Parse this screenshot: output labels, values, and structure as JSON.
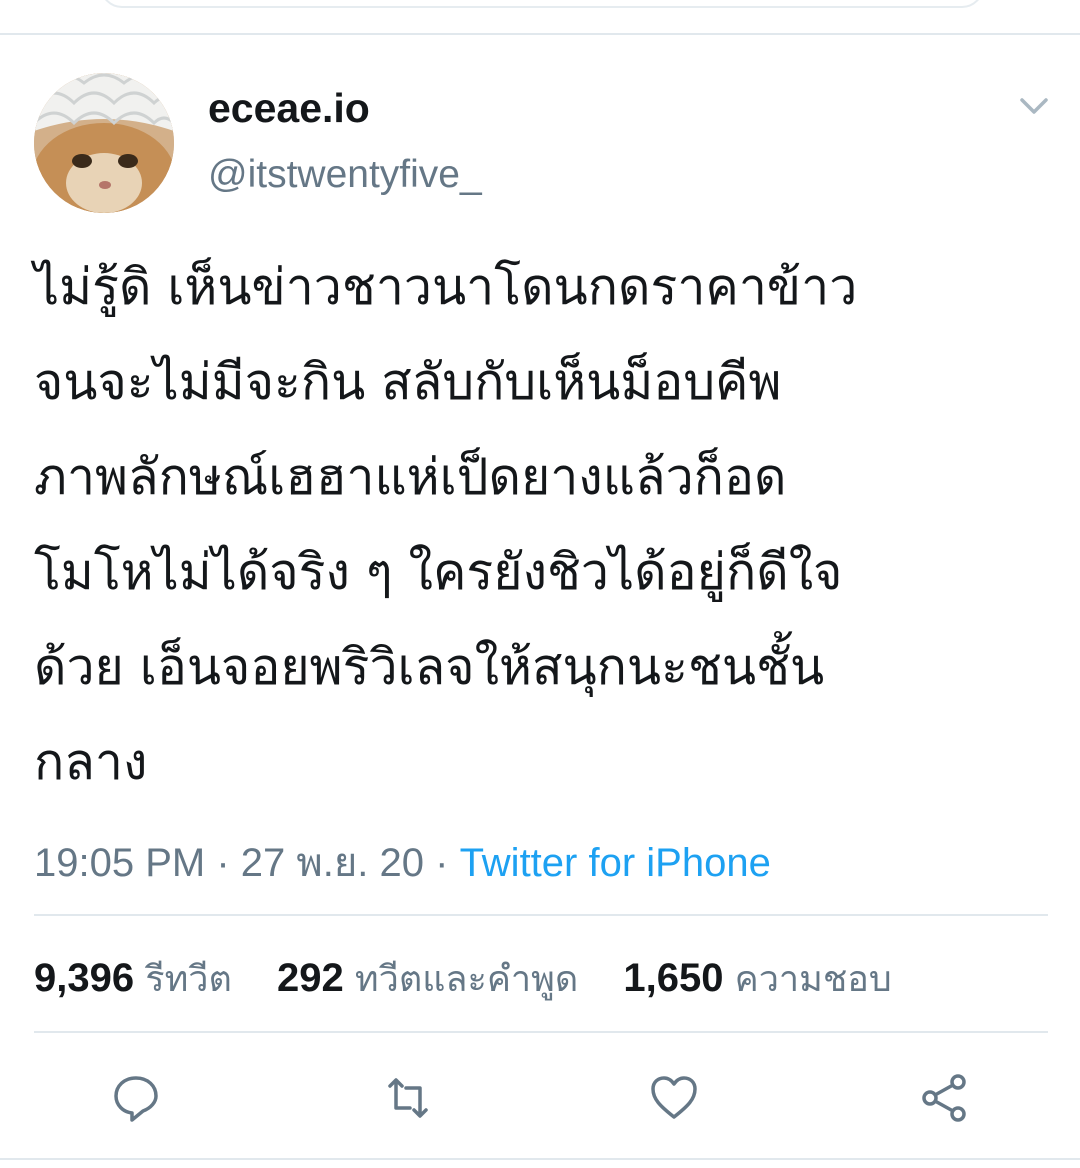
{
  "user": {
    "display_name": "eceae.io",
    "handle": "@itstwentyfive_"
  },
  "tweet": {
    "text": "ไม่รู้ดิ เห็นข่าวชาวนาโดนกดราคาข้าว\nจนจะไม่มีจะกิน สลับกับเห็นม็อบคีพ\nภาพลักษณ์เฮฮาแห่เป็ดยางแล้วก็อด\nโมโหไม่ได้จริง ๆ ใครยังชิวได้อยู่ก็ดีใจ\nด้วย เอ็นจอยพริวิเลจให้สนุกนะชนชั้น\nกลาง",
    "time": "19:05 PM",
    "date": "27 พ.ย. 20",
    "separator": " · ",
    "source": "Twitter for iPhone"
  },
  "stats": {
    "retweets_count": "9,396",
    "retweets_label": "รีทวีต",
    "quotes_count": "292",
    "quotes_label": "ทวีตและคำพูด",
    "likes_count": "1,650",
    "likes_label": "ความชอบ"
  },
  "icons": {
    "menu": "chevron-down-icon",
    "reply": "reply-icon",
    "retweet": "retweet-icon",
    "like": "heart-icon",
    "share": "share-icon"
  },
  "colors": {
    "link": "#1da1f2",
    "secondary_text": "#657786",
    "icon": "#657786",
    "divider": "#e1e8ed"
  }
}
